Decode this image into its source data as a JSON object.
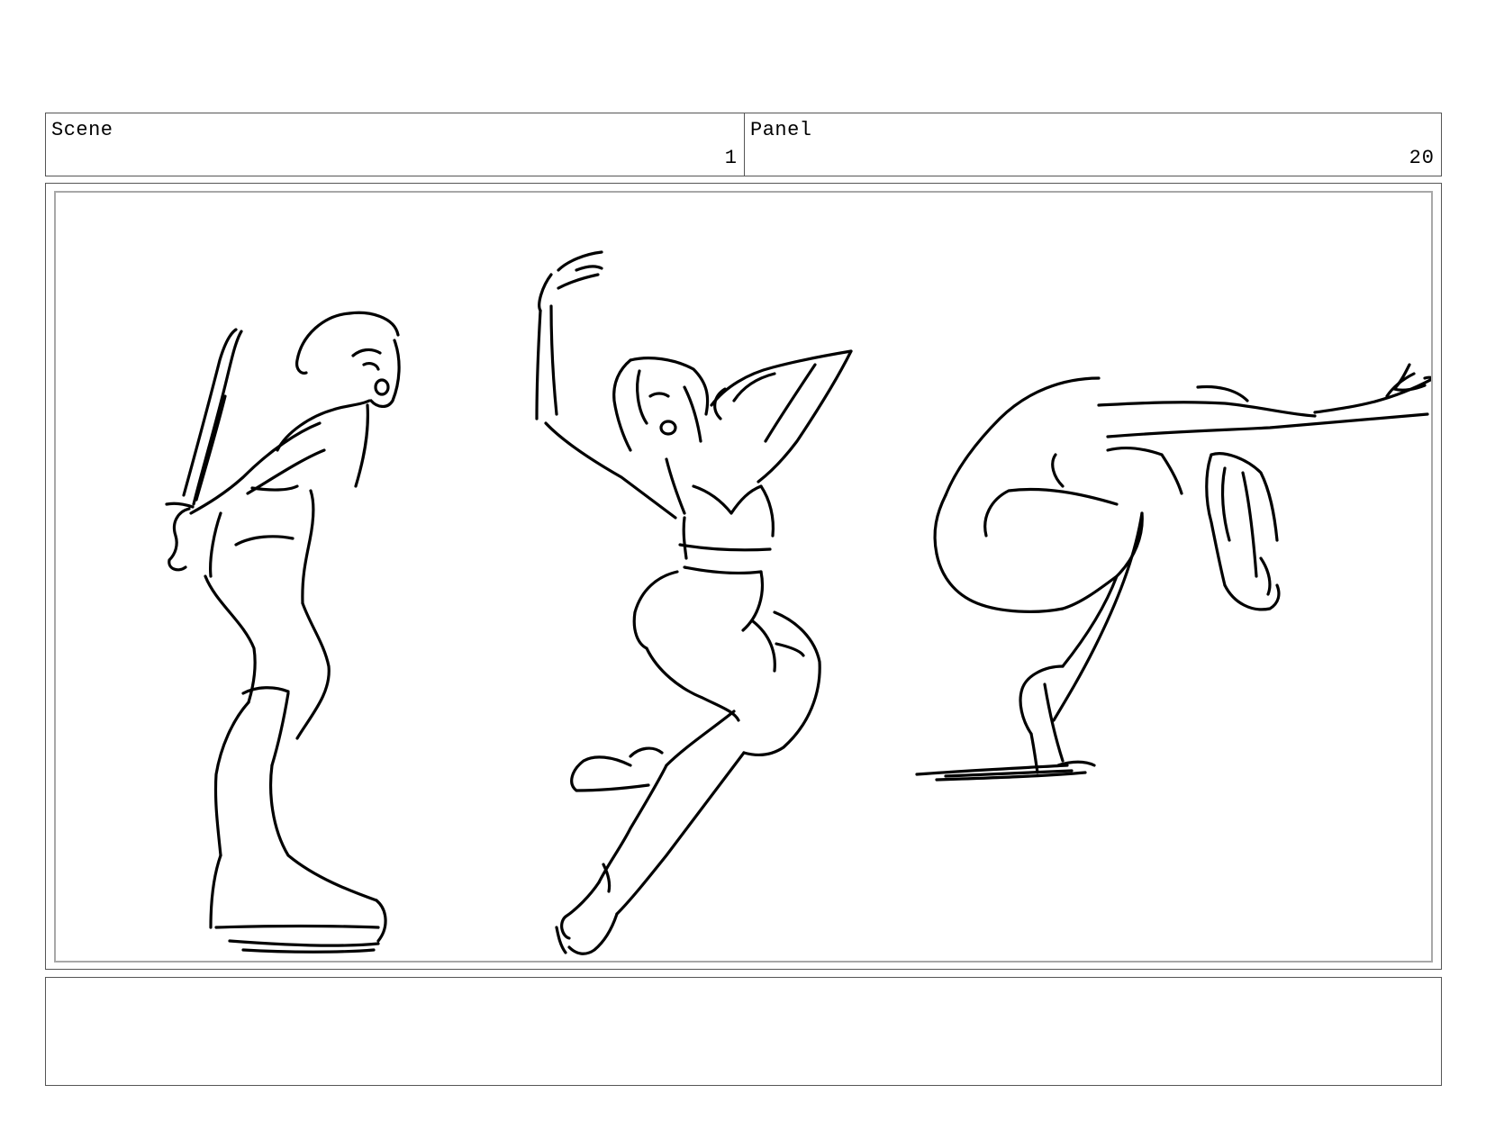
{
  "header": {
    "scene_label": "Scene",
    "scene_number": "1",
    "panel_label": "Panel",
    "panel_number": "20"
  },
  "notes": {
    "text": ""
  }
}
